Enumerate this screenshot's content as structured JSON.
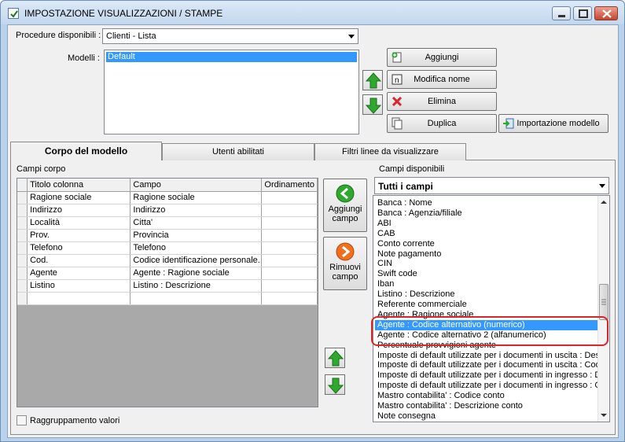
{
  "window": {
    "title": "IMPOSTAZIONE VISUALIZZAZIONI / STAMPE"
  },
  "procedure": {
    "label": "Procedure disponibili :",
    "value": "Clienti - Lista"
  },
  "modelli": {
    "label": "Modelli :",
    "items": [
      "Default"
    ]
  },
  "buttons": {
    "aggiungi": "Aggiungi",
    "modifica_nome": "Modifica nome",
    "elimina": "Elimina",
    "duplica": "Duplica",
    "importazione": "Importazione modello"
  },
  "tabs": [
    {
      "label": "Corpo del modello"
    },
    {
      "label": "Utenti abilitati"
    },
    {
      "label": "Filtri linee da visualizzare"
    }
  ],
  "campi_corpo": {
    "label": "Campi corpo",
    "headers": [
      "Titolo colonna",
      "Campo",
      "Ordinamento"
    ],
    "rows": [
      [
        "Ragione sociale",
        "Ragione sociale",
        ""
      ],
      [
        "Indirizzo",
        "Indirizzo",
        ""
      ],
      [
        "Località",
        "Citta'",
        ""
      ],
      [
        "Prov.",
        "Provincia",
        ""
      ],
      [
        "Telefono",
        "Telefono",
        ""
      ],
      [
        "Cod.",
        "Codice identificazione personale...",
        ""
      ],
      [
        "Agente",
        "Agente : Ragione sociale",
        ""
      ],
      [
        "Listino",
        "Listino : Descrizione",
        ""
      ],
      [
        "",
        "",
        ""
      ]
    ]
  },
  "mid_buttons": {
    "aggiungi_campo": [
      "Aggiungi",
      "campo"
    ],
    "rimuovi_campo": [
      "Rimuovi",
      "campo"
    ]
  },
  "campi_disponibili": {
    "label": "Campi disponibili",
    "filter": "Tutti i campi",
    "items": [
      "Banca : Nome",
      "Banca : Agenzia/filiale",
      "ABI",
      "CAB",
      "Conto corrente",
      "Note pagamento",
      "CIN",
      "Swift code",
      "Iban",
      "Listino : Descrizione",
      "Referente commerciale",
      "Agente : Ragione sociale",
      "Agente : Codice alternativo (numerico)",
      "Agente : Codice alternativo 2 (alfanumerico)",
      "Percentuale provvigioni agente",
      "Imposte di default utilizzate per i documenti in uscita : Des",
      "Imposte di default utilizzate per i documenti in uscita : Cod",
      "Imposte di default utilizzate per i documenti in ingresso : D",
      "Imposte di default utilizzate per i documenti in ingresso : Co",
      "Mastro contabilita' : Codice conto",
      "Mastro contabilita' : Descrizione conto",
      "Note consegna"
    ],
    "selected_item": "Agente : Codice alternativo (numerico)"
  },
  "raggruppamento": {
    "label": "Raggruppamento valori",
    "checked": false
  },
  "colors": {
    "accent": "#3399ff",
    "highlight": "#d9262b",
    "green_arrow": "#2fa82f",
    "orange_arrow": "#f07020"
  }
}
